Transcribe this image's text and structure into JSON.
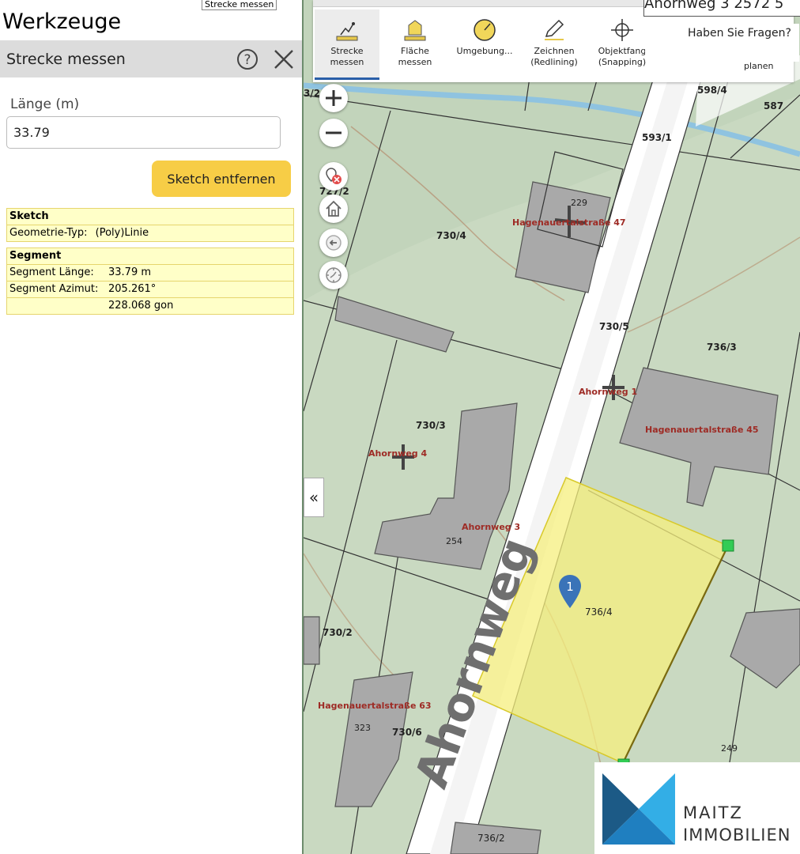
{
  "left_panel": {
    "tooltip_tab": "Strecke messen",
    "title": "Werkzeuge",
    "tool_header": "Strecke messen",
    "length_label": "Länge (m)",
    "length_value": "33.79",
    "remove_sketch_label": "Sketch entfernen",
    "sketch_box": {
      "header": "Sketch",
      "rows": [
        {
          "key": "Geometrie-Typ:",
          "value": "(Poly)Linie"
        }
      ]
    },
    "segment_box": {
      "header": "Segment",
      "rows": [
        {
          "key": "Segment Länge:",
          "value": "33.79 m"
        },
        {
          "key": "Segment Azimut:",
          "value": "205.261°"
        },
        {
          "key": "",
          "value": "228.068 gon"
        }
      ]
    }
  },
  "toolbar": {
    "tools": [
      {
        "label1": "Strecke",
        "label2": "messen",
        "icon": "measure-line-icon",
        "active": true
      },
      {
        "label1": "Fläche",
        "label2": "messen",
        "icon": "measure-area-icon",
        "active": false
      },
      {
        "label1": "Umgebung...",
        "label2": "",
        "icon": "radius-icon",
        "active": false
      },
      {
        "label1": "Zeichnen",
        "label2": "(Redlining)",
        "icon": "pencil-icon",
        "active": false
      },
      {
        "label1": "Objektfang",
        "label2": "(Snapping)",
        "icon": "crosshair-icon",
        "active": false
      }
    ],
    "planen_label": "planen",
    "question_text": "Haben Sie Fragen?",
    "address_top": "Ahornweg 3 2572 5"
  },
  "map": {
    "collapse_symbol": "«",
    "marker_number": "1",
    "parcel_labels": [
      "3/2",
      "598/4",
      "587",
      "593/1",
      "727/2",
      "730/4",
      "730/5",
      "736/3",
      "730/3",
      "736/4",
      "730/2",
      "730/6",
      "736/2"
    ],
    "point_labels": [
      "229",
      "254",
      "323",
      "249"
    ],
    "street_labels": [
      "Hagenauertalstraße 47",
      "Ahornweg 1",
      "Hagenauertalstraße 45",
      "Ahornweg 4",
      "Ahornweg 3",
      "Hagenauertalstraße 63"
    ],
    "road_name": "Ahornweg",
    "house_numbers": [
      "47",
      "45",
      "1",
      "4",
      "63"
    ]
  },
  "logo": {
    "line1": "MAITZ",
    "line2": "IMMOBILIEN"
  },
  "colors": {
    "accent_button": "#f7cd46",
    "info_box": "#ffffc8",
    "measure_area": "#f5ef7e",
    "marker": "#3a73b8",
    "snap_point": "#33cc55",
    "label_red": "#9e2b25",
    "logo_dark": "#1c5a86",
    "logo_light": "#33aee6"
  }
}
